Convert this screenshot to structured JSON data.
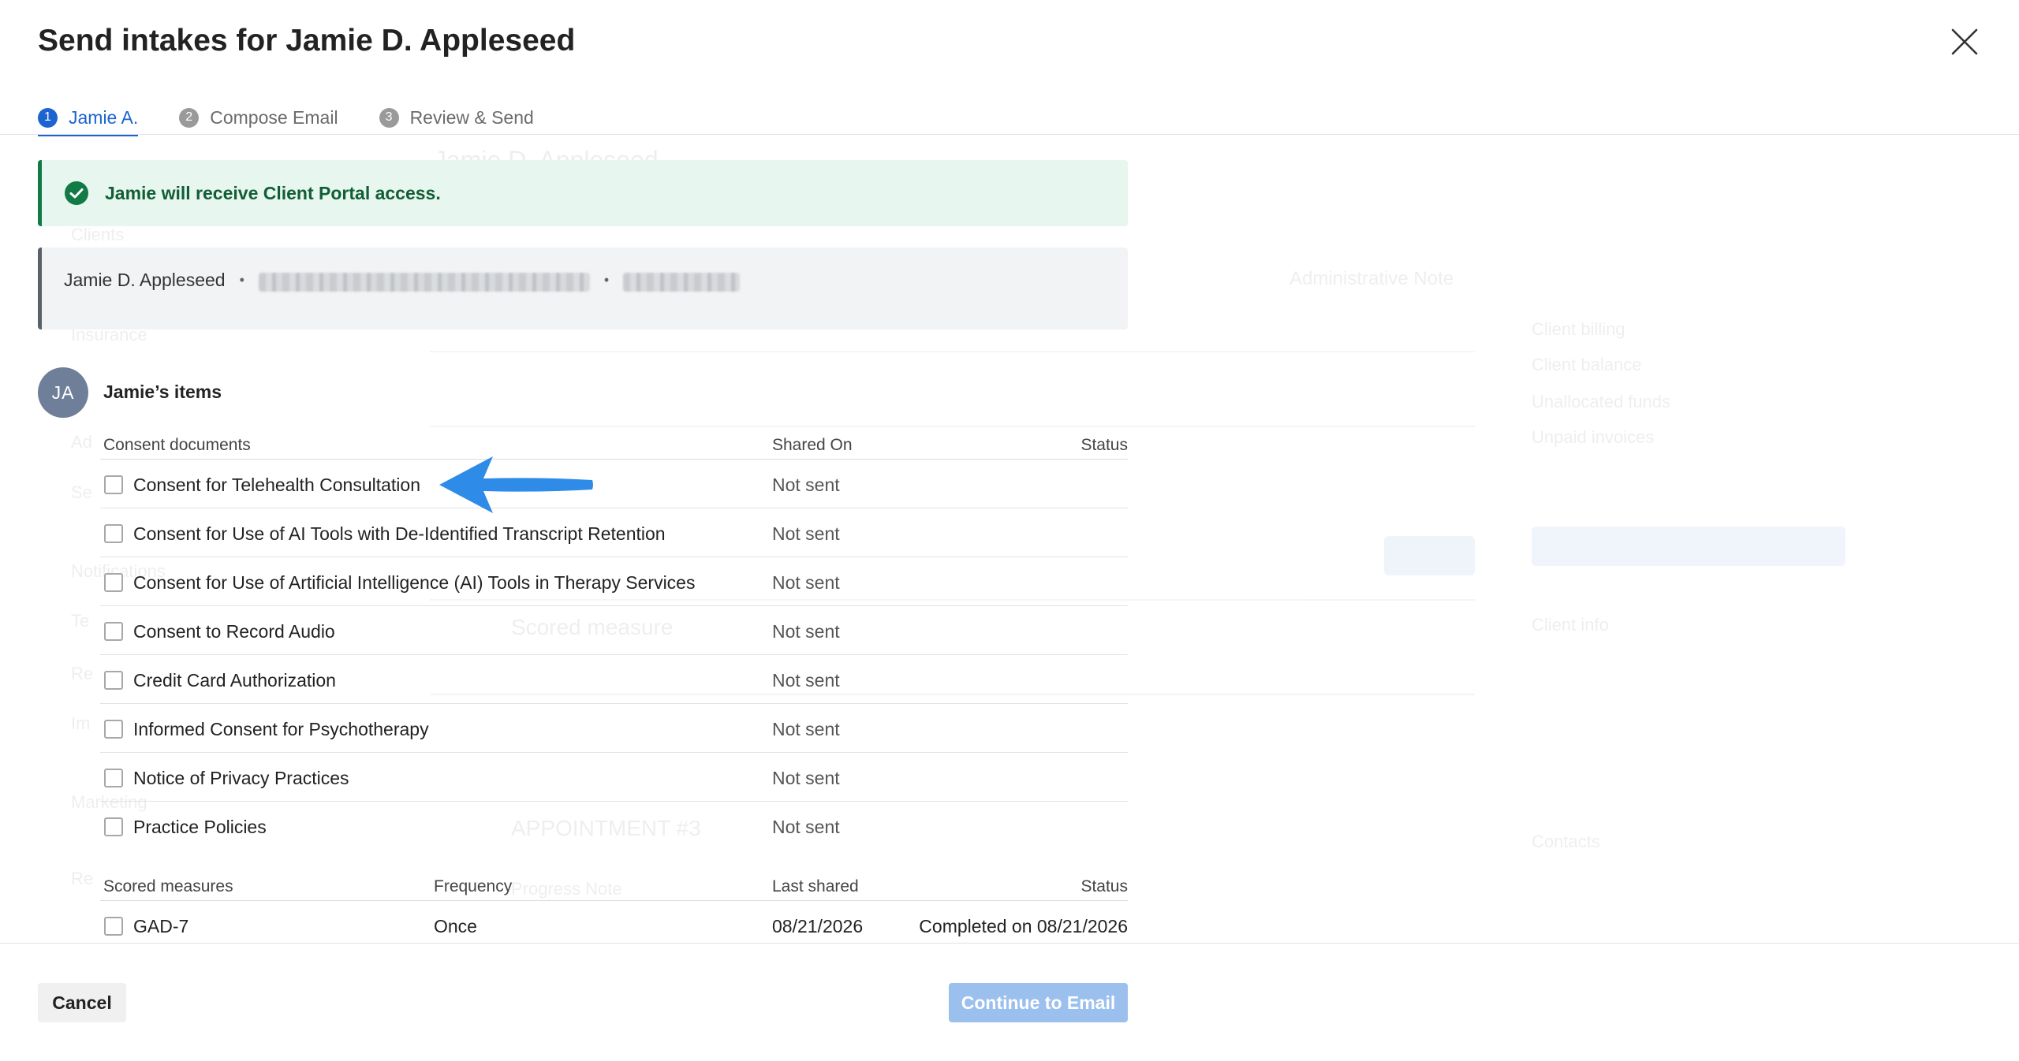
{
  "dialog": {
    "title": "Send intakes for Jamie D. Appleseed",
    "close_icon": "close-icon"
  },
  "steps": [
    {
      "number": "1",
      "label": "Jamie A.",
      "active": true
    },
    {
      "number": "2",
      "label": "Compose Email",
      "active": false
    },
    {
      "number": "3",
      "label": "Review & Send",
      "active": false
    }
  ],
  "banner": {
    "text": "Jamie will receive Client Portal access.",
    "icon": "check-circle-icon",
    "color": "#117a45"
  },
  "client": {
    "name": "Jamie D. Appleseed",
    "separator": "•"
  },
  "items": {
    "avatar_initials": "JA",
    "title": "Jamie’s items"
  },
  "consent_table": {
    "headers": {
      "name": "Consent documents",
      "shared_on": "Shared On",
      "status": "Status"
    },
    "rows": [
      {
        "name": "Consent for Telehealth Consultation",
        "shared_on": "Not sent"
      },
      {
        "name": "Consent for Use of AI Tools with De-Identified Transcript Retention",
        "shared_on": "Not sent"
      },
      {
        "name": "Consent for Use of Artificial Intelligence (AI) Tools in Therapy Services",
        "shared_on": "Not sent"
      },
      {
        "name": "Consent to Record Audio",
        "shared_on": "Not sent"
      },
      {
        "name": "Credit Card Authorization",
        "shared_on": "Not sent"
      },
      {
        "name": "Informed Consent for Psychotherapy",
        "shared_on": "Not sent"
      },
      {
        "name": "Notice of Privacy Practices",
        "shared_on": "Not sent"
      },
      {
        "name": "Practice Policies",
        "shared_on": "Not sent"
      }
    ]
  },
  "measures_table": {
    "headers": {
      "name": "Scored measures",
      "frequency": "Frequency",
      "last_shared": "Last shared",
      "status": "Status"
    },
    "rows": [
      {
        "name": "GAD-7",
        "frequency": "Once",
        "last_shared": "08/21/2026",
        "status": "Completed on 08/21/2026"
      }
    ]
  },
  "footer": {
    "cancel_label": "Cancel",
    "continue_label": "Continue to Email"
  },
  "colors": {
    "accent": "#1c64d0",
    "annotation_arrow": "#2f8be8",
    "continue_disabled": "#9cc0ee"
  }
}
